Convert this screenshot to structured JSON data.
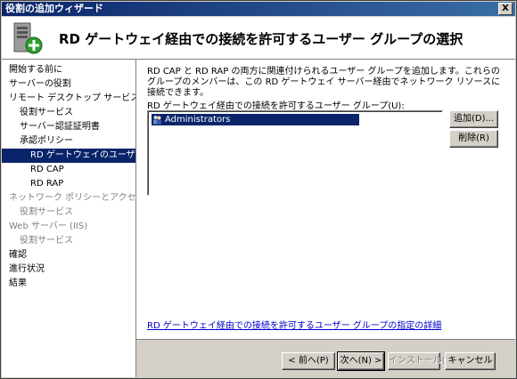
{
  "window": {
    "title": "役割の追加ウィザード",
    "close_label": "X"
  },
  "header": {
    "title": "RD ゲートウェイ経由での接続を許可するユーザー グループの選択"
  },
  "sidebar": {
    "items": [
      {
        "label": "開始する前に",
        "indent": 0,
        "state": "normal"
      },
      {
        "label": "サーバーの役割",
        "indent": 0,
        "state": "normal"
      },
      {
        "label": "リモート デスクトップ サービス",
        "indent": 0,
        "state": "normal"
      },
      {
        "label": "役割サービス",
        "indent": 1,
        "state": "normal"
      },
      {
        "label": "サーバー認証証明書",
        "indent": 1,
        "state": "normal"
      },
      {
        "label": "承認ポリシー",
        "indent": 1,
        "state": "normal"
      },
      {
        "label": "RD ゲートウェイのユーザー グ...",
        "indent": 2,
        "state": "selected"
      },
      {
        "label": "RD CAP",
        "indent": 2,
        "state": "normal"
      },
      {
        "label": "RD RAP",
        "indent": 2,
        "state": "normal"
      },
      {
        "label": "ネットワーク ポリシーとアクセス サービ...",
        "indent": 0,
        "state": "disabled"
      },
      {
        "label": "役割サービス",
        "indent": 1,
        "state": "disabled"
      },
      {
        "label": "Web サーバー (IIS)",
        "indent": 0,
        "state": "disabled"
      },
      {
        "label": "役割サービス",
        "indent": 1,
        "state": "disabled"
      },
      {
        "label": "確認",
        "indent": 0,
        "state": "normal"
      },
      {
        "label": "進行状況",
        "indent": 0,
        "state": "normal"
      },
      {
        "label": "結果",
        "indent": 0,
        "state": "normal"
      }
    ]
  },
  "main": {
    "description": "RD CAP と RD RAP の両方に関連付けられるユーザー グループを追加します。これらのグループのメンバーは、この RD ゲートウェイ サーバー経由でネットワーク リソースに接続できます。",
    "list_label": "RD ゲートウェイ経由での接続を許可するユーザー グループ(U):",
    "groups": [
      "Administrators"
    ],
    "add_button": "追加(D)...",
    "remove_button": "削除(R)",
    "help_link": "RD ゲートウェイ経由での接続を許可するユーザー グループの指定の詳細"
  },
  "footer": {
    "back": "< 前へ(P)",
    "next": "次へ(N) >",
    "install": "インストール(I)",
    "cancel": "キャンセル"
  }
}
